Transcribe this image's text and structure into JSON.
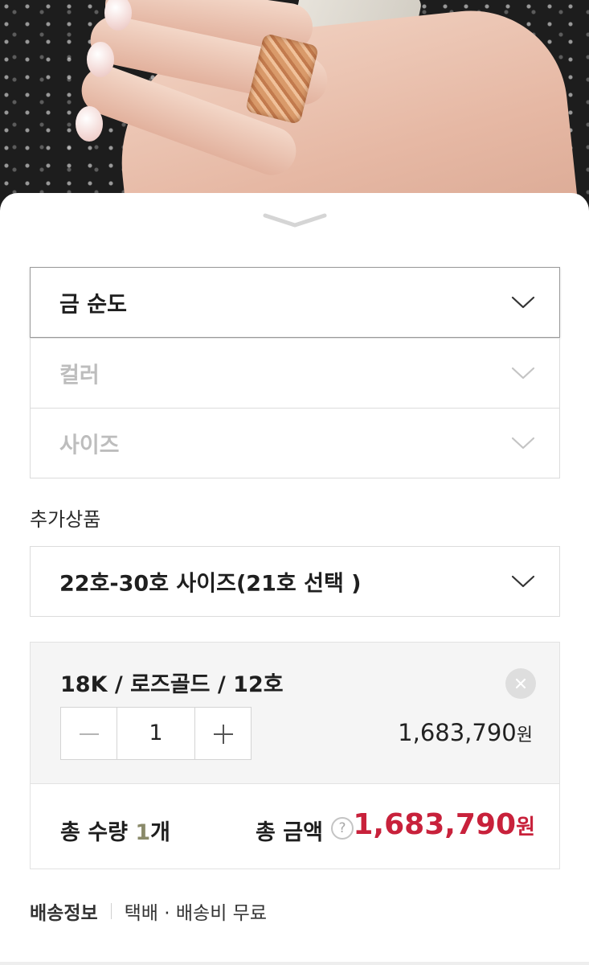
{
  "options": {
    "gold_purity": {
      "label": "금 순도"
    },
    "color": {
      "label": "컬러"
    },
    "size": {
      "label": "사이즈"
    }
  },
  "additional": {
    "title": "추가상품",
    "select_label": "22호-30호 사이즈(21호 선택 )"
  },
  "selected_item": {
    "name": "18K / 로즈골드 / 12호",
    "quantity": "1",
    "price": "1,683,790",
    "currency": "원"
  },
  "totals": {
    "qty_label": "총 수량",
    "qty_value": "1",
    "qty_unit": "개",
    "amount_label": "총 금액",
    "help_glyph": "?",
    "amount_value": "1,683,790",
    "currency": "원"
  },
  "shipping": {
    "title": "배송정보",
    "info": "택배 · 배송비 무료"
  },
  "colors": {
    "price_red": "#c8213b",
    "qty_accent": "#8a8a6a",
    "option_bg": "#f5f5f5"
  },
  "icons": [
    "chevron-down-icon",
    "close-icon",
    "minus-icon",
    "plus-icon",
    "help-icon"
  ]
}
